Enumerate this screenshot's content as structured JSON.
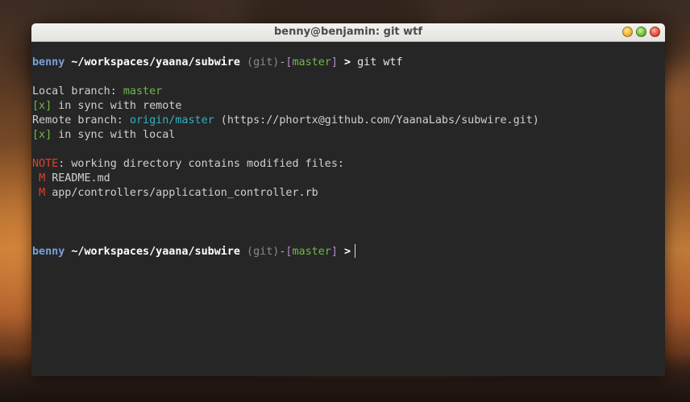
{
  "window": {
    "title": "benny@benjamin: git wtf"
  },
  "prompt": {
    "user": "benny",
    "path": "~/workspaces/yaana/subwire",
    "git_label": "(git)",
    "dash": "-",
    "bracket_open": "[",
    "branch": "master",
    "bracket_close": "]",
    "symbol": ">"
  },
  "command": "git wtf",
  "output": {
    "local_label": "Local branch: ",
    "local_branch": "master",
    "local_check": "[x]",
    "local_sync": " in sync with remote",
    "remote_label": "Remote branch: ",
    "remote_branch": "origin/master",
    "remote_url": " (https://phortx@github.com/YaanaLabs/subwire.git)",
    "remote_check": "[x]",
    "remote_sync": " in sync with local",
    "note_label": "NOTE",
    "note_text": ": working directory contains modified files:",
    "modified_files": [
      {
        "status": "M",
        "path": "README.md"
      },
      {
        "status": "M",
        "path": "app/controllers/application_controller.rb"
      }
    ]
  },
  "colors": {
    "user": "#7a9fd8",
    "branch": "#73b84a",
    "remote": "#2fb3c0",
    "note": "#e0402a",
    "terminal_bg": "#262626"
  }
}
